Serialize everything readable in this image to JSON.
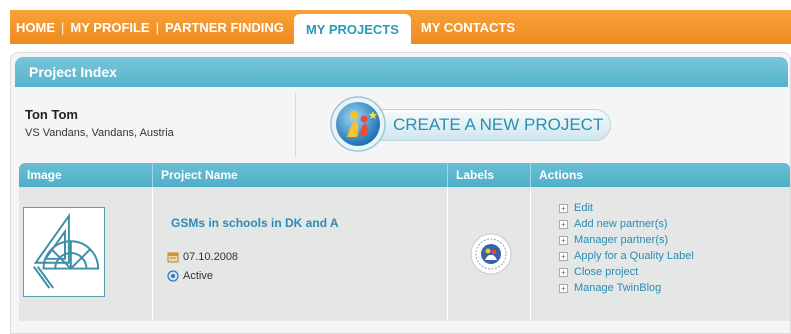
{
  "nav": {
    "items": [
      {
        "label": "HOME",
        "active": false
      },
      {
        "label": "MY PROFILE",
        "active": false
      },
      {
        "label": "PARTNER FINDING",
        "active": false
      },
      {
        "label": "MY PROJECTS",
        "active": true
      },
      {
        "label": "MY CONTACTS",
        "active": false
      }
    ]
  },
  "panel": {
    "title": "Project Index"
  },
  "owner": {
    "name": "Ton Tom",
    "location": "VS Vandans, Vandans, Austria"
  },
  "create_button": {
    "label": "CREATE A NEW PROJECT"
  },
  "table": {
    "headers": {
      "image": "Image",
      "name": "Project Name",
      "labels": "Labels",
      "actions": "Actions"
    },
    "rows": [
      {
        "name": "GSMs in schools in DK and A",
        "date": "07.10.2008",
        "status": "Active",
        "actions": [
          "Edit",
          "Add new partner(s)",
          "Manager partner(s)",
          "Apply for a Quality Label",
          "Close project",
          "Manage TwinBlog"
        ]
      }
    ]
  },
  "colors": {
    "nav_orange": "#ef8a1e",
    "header_teal": "#55b3cc",
    "link_blue": "#2a8db2"
  },
  "icons": [
    "globe-logo-icon",
    "geometry-thumbnail-icon",
    "calendar-icon",
    "status-active-icon",
    "quality-label-icon",
    "plus-icon"
  ]
}
